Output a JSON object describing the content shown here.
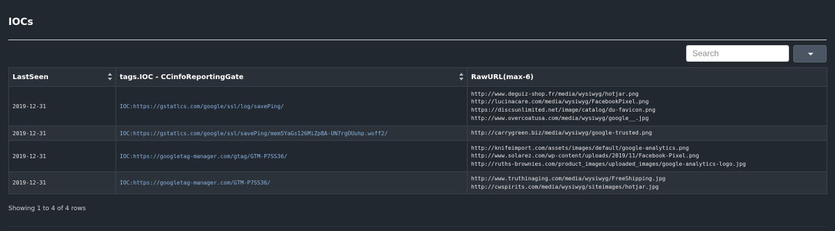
{
  "panel": {
    "title": "IOCs",
    "search_placeholder": "Search",
    "footer": "Showing 1 to 4 of 4 rows"
  },
  "table": {
    "headers": [
      "LastSeen",
      "tags.IOC - CCinfoReportingGate",
      "RawURL(max-6)"
    ],
    "rows": [
      {
        "last_seen": "2019-12-31",
        "ioc": "IOC:https://gstatlcs.com/google/ssl/log/savePing/",
        "urls": [
          "http://www.deguiz-shop.fr/media/wysiwyg/hotjar.png",
          "http://lucinacare.com/media/wysiwyg/FacebookPixel.png",
          "https://discsunlimited.net/image/catalog/du-favicon.png",
          "http://www.overcoatusa.com/media/wysiwyg/google__.jpg"
        ]
      },
      {
        "last_seen": "2019-12-31",
        "ioc": "IOC:https://gstatlcs.com/google/ssl/savePing/mem5YaGs126MiZpBA-UN7rgOUuhp.woff2/",
        "urls": [
          "http://carrygreen.biz/media/wysiwyg/google-trusted.png"
        ]
      },
      {
        "last_seen": "2019-12-31",
        "ioc": "IOC:https://googletag-manager.com/gtag/GTM-P7SS36/",
        "urls": [
          "http://knifeimport.com/assets/images/default/google-analytics.png",
          "http://www.solarez.com/wp-content/uploads/2019/11/Facebook-Pixel.png",
          "http://ruths-brownies.com/product_images/uploaded_images/google-analytics-logo.jpg"
        ]
      },
      {
        "last_seen": "2019-12-31",
        "ioc": "IOC:https://googletag-manager.com/GTM-P7SS36/",
        "urls": [
          "http://www.truthinaging.com/media/wysiwyg/FreeShipping.jpg",
          "http://cwspirits.com/media/wysiwyg/siteimages/hotjar.jpg"
        ]
      }
    ]
  }
}
